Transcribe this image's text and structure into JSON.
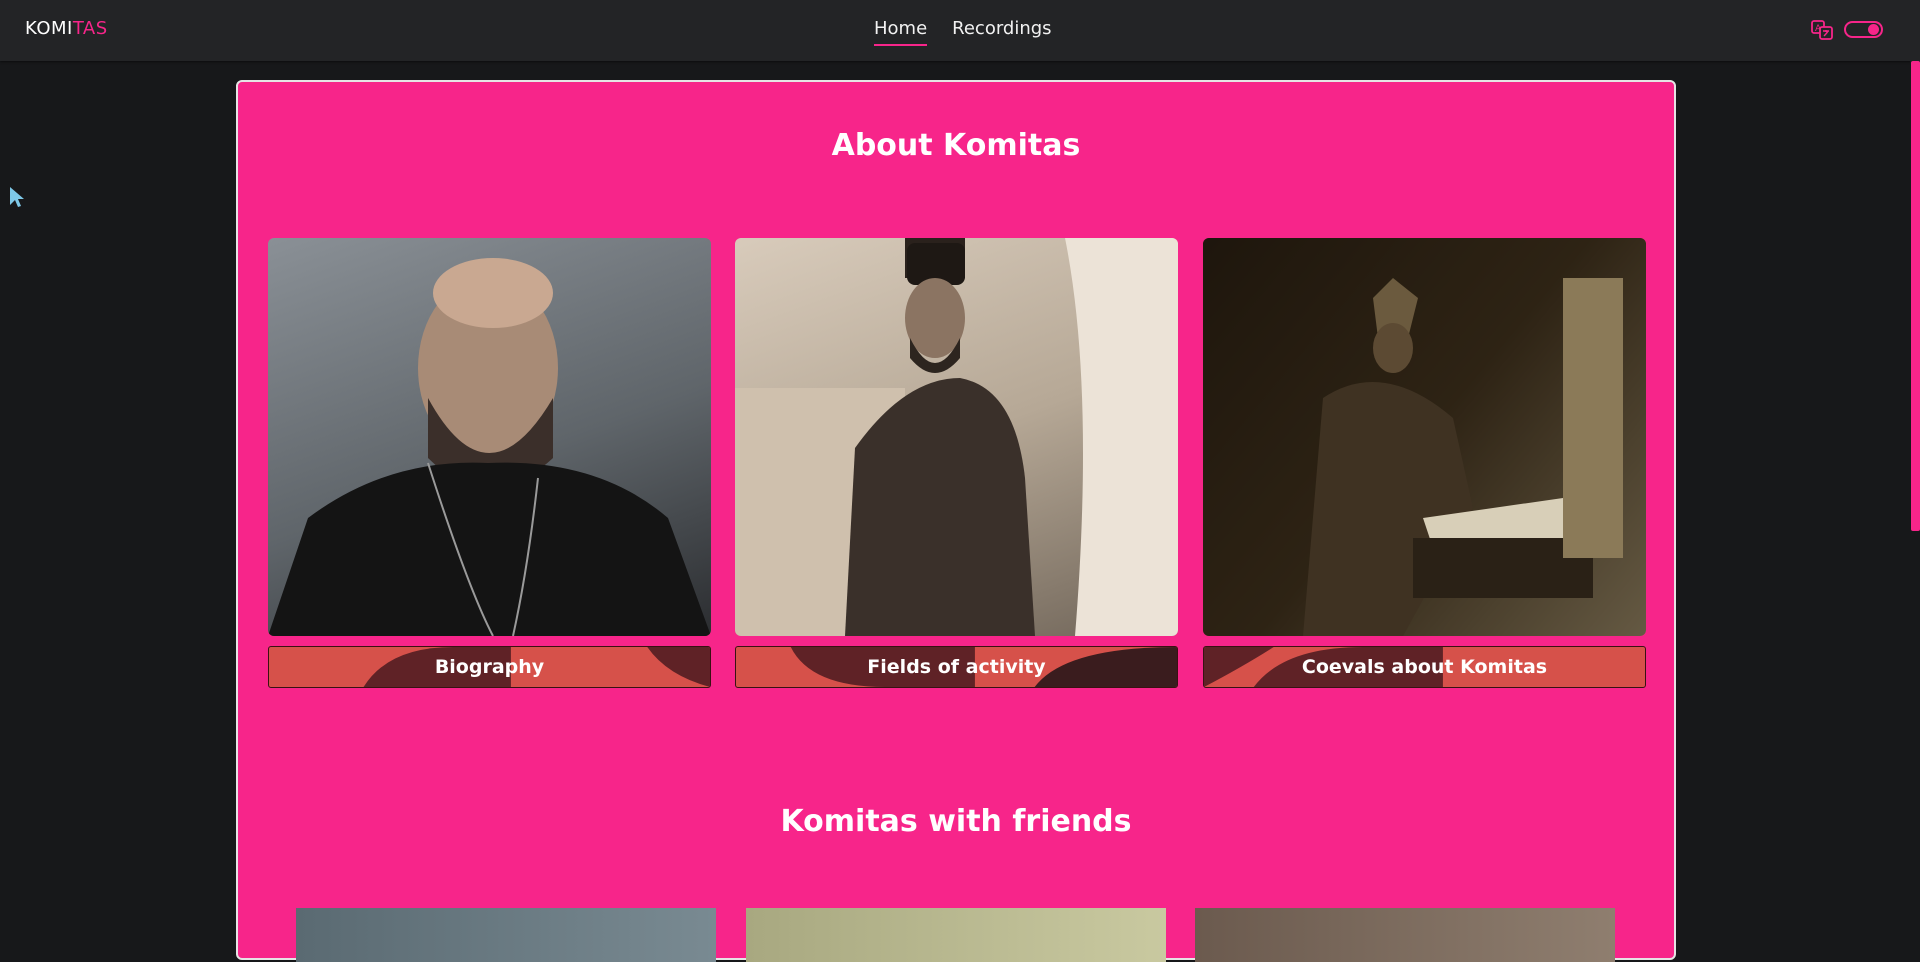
{
  "nav": {
    "brand_part1": "KOMI",
    "brand_part2": "TAS",
    "links": [
      {
        "label": "Home",
        "active": true
      },
      {
        "label": "Recordings",
        "active": false
      }
    ],
    "language_icon": "translate-icon",
    "theme_toggle_icon": "toggle-icon"
  },
  "about": {
    "title": "About Komitas",
    "cards": [
      {
        "label": "Biography",
        "image": "portrait-photo"
      },
      {
        "label": "Fields of activity",
        "image": "standing-portrait-photo"
      },
      {
        "label": "Coevals about Komitas",
        "image": "writing-at-desk-photo"
      }
    ]
  },
  "friends": {
    "title": "Komitas with friends"
  },
  "colors": {
    "accent": "#f7258a",
    "page_bg": "#17181a",
    "navbar_bg": "#232426",
    "label_bg": "#d6514a"
  }
}
